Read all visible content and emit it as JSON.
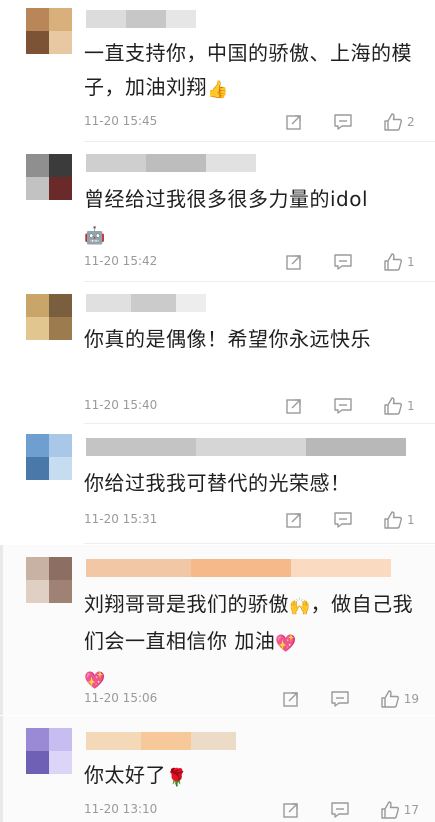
{
  "comments": [
    {
      "avatar_colors": [
        "#b9865a",
        "#d9b07c",
        "#7d5336",
        "#e7c8a0",
        "#5a3a28",
        "#c79a6b"
      ],
      "name_colors": [
        "#dcdcdc",
        "#c7c7c7",
        "#e6e6e6"
      ],
      "text": "一直支持你，中国的骄傲、上海的模子，加油刘翔",
      "emoji": "👍",
      "time": "11-20 15:45",
      "likes": "2"
    },
    {
      "avatar_colors": [
        "#8f8f8f",
        "#3b3b3b",
        "#c2c2c2",
        "#6a2a2a",
        "#d8d8d8",
        "#555555"
      ],
      "name_colors": [
        "#cfcfcf",
        "#bdbdbd",
        "#e1e1e1"
      ],
      "text": "曾经给过我很多很多力量的idol",
      "emoji": "🤖",
      "time": "11-20 15:42",
      "likes": "1"
    },
    {
      "avatar_colors": [
        "#c9a56a",
        "#7a5f3f",
        "#e2c690",
        "#9c7b4f",
        "#d8b77f",
        "#b08a55"
      ],
      "name_colors": [
        "#e0e0e0",
        "#cbcbcb",
        "#ededed"
      ],
      "text": "你真的是偶像！希望你永远快乐",
      "emoji": "",
      "time": "11-20 15:40",
      "likes": "1"
    },
    {
      "avatar_colors": [
        "#6f9fd0",
        "#a9c7e6",
        "#4a78a8",
        "#c6dcf1",
        "#8bb3da",
        "#d9e7f5"
      ],
      "name_colors": [
        "#c4c4c4",
        "#d6d6d6",
        "#b8b8b8"
      ],
      "text": "你给过我我可替代的光荣感！",
      "emoji": "",
      "time": "11-20 15:31",
      "likes": "1"
    },
    {
      "avatar_colors": [
        "#c7b2a3",
        "#8d6e63",
        "#e0cfc3",
        "#a08274",
        "#d3c0b3",
        "#f0e6de"
      ],
      "name_colors": [
        "#f2c7a6",
        "#f6b98a",
        "#fadbc2"
      ],
      "text": "刘翔哥哥是我们的骄傲",
      "text2": "，做自己我们会一直相信你 加油",
      "emoji": "🙌",
      "emoji2": "💖",
      "emoji3": "💖",
      "time": "11-20 15:06",
      "likes": "19"
    },
    {
      "avatar_colors": [
        "#9a8ad6",
        "#c7bdf0",
        "#6f5fb5",
        "#dcd5f7",
        "#b3a7e6",
        "#857ac7"
      ],
      "name_colors": [
        "#f3d9b8",
        "#f7c99a",
        "#ecdcc7"
      ],
      "text": "你太好了",
      "emoji": "🌹",
      "time": "11-20 13:10",
      "likes": "17"
    }
  ]
}
